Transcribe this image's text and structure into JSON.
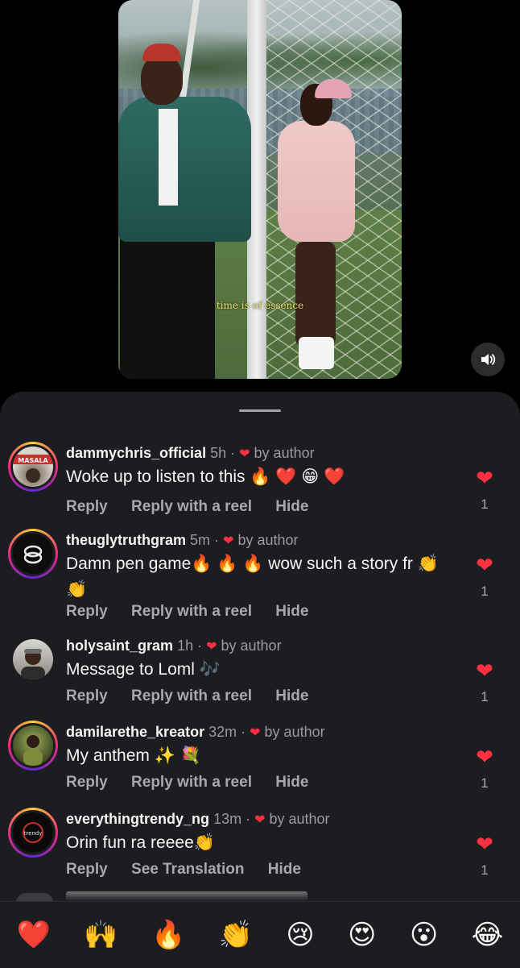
{
  "video": {
    "caption": "time is of essence",
    "mute_icon": "speaker-icon"
  },
  "comments": [
    {
      "username": "dammychris_official",
      "time": "5h",
      "author_badge": "by author",
      "text": "Woke up to listen to this 🔥 ❤️ 😁 ❤️",
      "actions": [
        "Reply",
        "Reply with a reel",
        "Hide"
      ],
      "likes": "1",
      "avatar_label": "MASALA"
    },
    {
      "username": "theuglytruthgram",
      "time": "5m",
      "author_badge": "by author",
      "text": "Damn pen game🔥 🔥 🔥  wow such a story fr 👏 👏",
      "actions": [
        "Reply",
        "Reply with a reel",
        "Hide"
      ],
      "likes": "1"
    },
    {
      "username": "holysaint_gram",
      "time": "1h",
      "author_badge": "by author",
      "text": "Message to Loml 🎶",
      "actions": [
        "Reply",
        "Reply with a reel",
        "Hide"
      ],
      "likes": "1"
    },
    {
      "username": "damilarethe_kreator",
      "time": "32m",
      "author_badge": "by author",
      "text": "My anthem ✨ 💐",
      "actions": [
        "Reply",
        "Reply with a reel",
        "Hide"
      ],
      "likes": "1"
    },
    {
      "username": "everythingtrendy_ng",
      "time": "13m",
      "author_badge": "by author",
      "text": "Orin fun ra reeee👏",
      "actions": [
        "Reply",
        "See Translation",
        "Hide"
      ],
      "likes": "1",
      "avatar_label": "trendy"
    }
  ],
  "emoji_bar": [
    "❤️",
    "🙌",
    "🔥",
    "👏",
    "😢",
    "😍",
    "😮",
    "😂"
  ],
  "colors": {
    "sheet_bg": "#1c1d20",
    "heart": "#ff3040",
    "muted_text": "#a8a8ae"
  }
}
